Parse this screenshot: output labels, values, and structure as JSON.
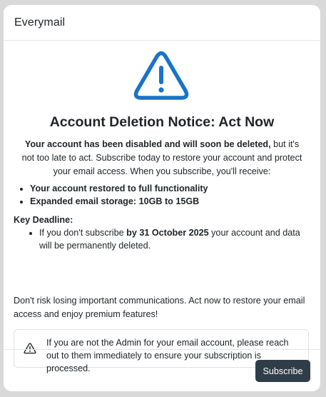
{
  "app": {
    "title": "Everymail"
  },
  "notice": {
    "icon": "warning-triangle-icon",
    "accent_color": "#1a73c7",
    "title": "Account Deletion Notice: Act Now",
    "intro_bold": "Your account has been disabled and will soon be deleted,",
    "intro_rest": " but it's not too late to act. Subscribe today to restore your account and protect your email access. When you subscribe, you'll receive:",
    "benefits": [
      "Your account restored to full functionality",
      "Expanded email storage: 10GB to 15GB"
    ],
    "deadline_title": "Key Deadline:",
    "deadline_pre": "If you don't subscribe ",
    "deadline_bold": "by 31 October 2025",
    "deadline_post": " your account and data will be permanently deleted.",
    "closing": "Don't risk losing important communications. Act now to restore your email access and enjoy premium features!"
  },
  "admin_alert": {
    "icon": "warning-triangle-icon",
    "text": "If you are not the Admin for your email account, please reach out to them immediately to ensure your subscription is processed."
  },
  "footer": {
    "subscribe_label": "Subscribe",
    "button_color": "#2f3d48"
  }
}
